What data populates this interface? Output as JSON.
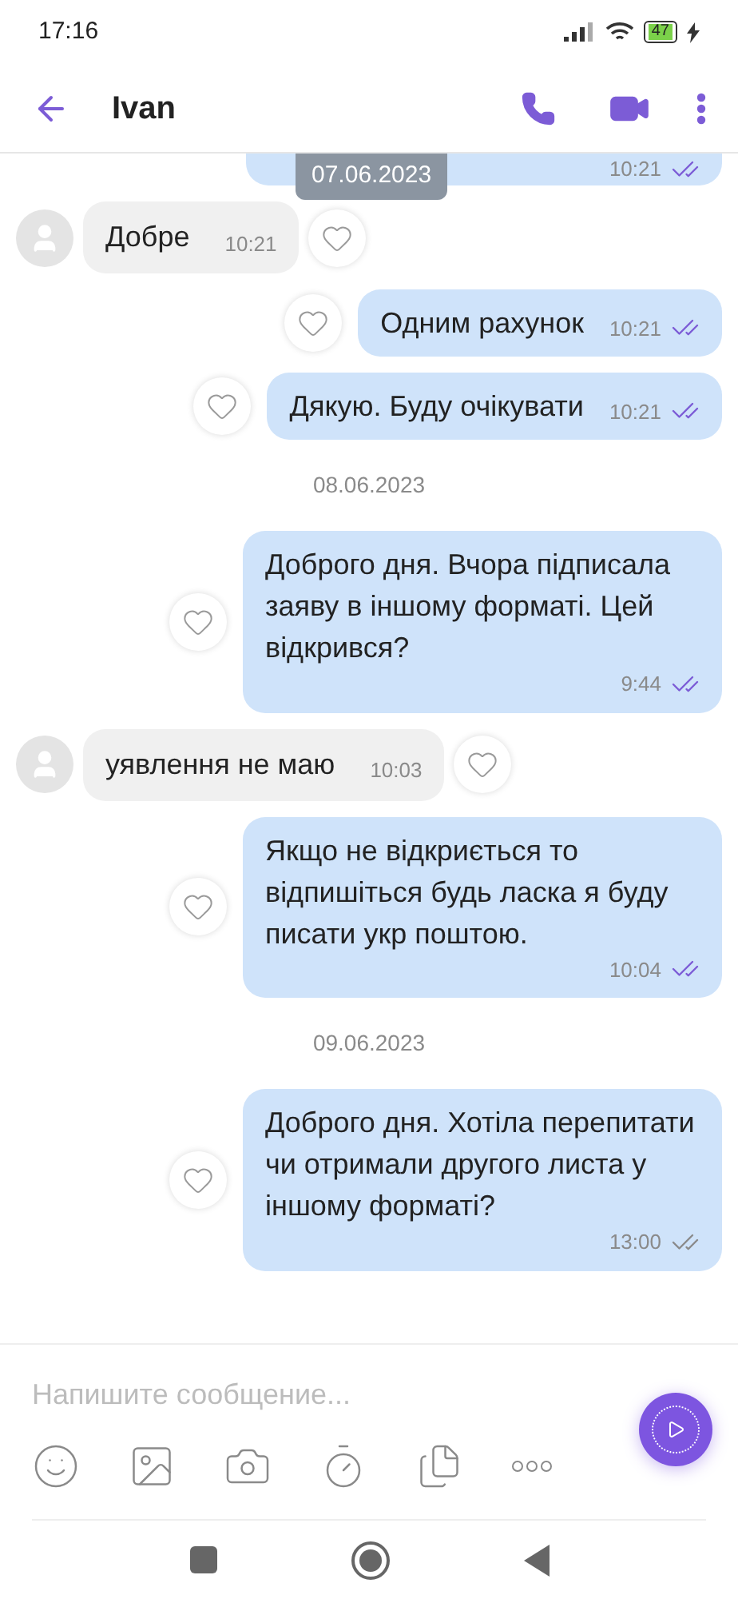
{
  "status_bar": {
    "time": "17:16",
    "battery": "47"
  },
  "header": {
    "title": "Ivan"
  },
  "sticky_date": "07.06.2023",
  "messages": [
    {
      "kind": "partial",
      "time": "10:21",
      "read": true
    },
    {
      "kind": "incoming",
      "text": "Добре",
      "time": "10:21"
    },
    {
      "kind": "outgoing",
      "text": "Одним рахунок",
      "time": "10:21",
      "read": true
    },
    {
      "kind": "outgoing",
      "text": "Дякую. Буду очікувати",
      "time": "10:21",
      "read": true
    },
    {
      "kind": "date",
      "text": "08.06.2023"
    },
    {
      "kind": "outgoing",
      "text": "Доброго дня. Вчора підписала заяву в іншому форматі. Цей відкрився?",
      "time": "9:44",
      "read": true
    },
    {
      "kind": "incoming",
      "text": "уявлення не маю",
      "time": "10:03"
    },
    {
      "kind": "outgoing",
      "text": "Якщо не відкриється то відпишіться будь ласка я буду писати укр поштою.",
      "time": "10:04",
      "read": true
    },
    {
      "kind": "date",
      "text": "09.06.2023"
    },
    {
      "kind": "outgoing",
      "text": "Доброго дня. Хотіла перепитати чи отримали другого листа у іншому форматі?",
      "time": "13:00",
      "read": false
    }
  ],
  "composer": {
    "placeholder": "Напишите сообщение..."
  }
}
